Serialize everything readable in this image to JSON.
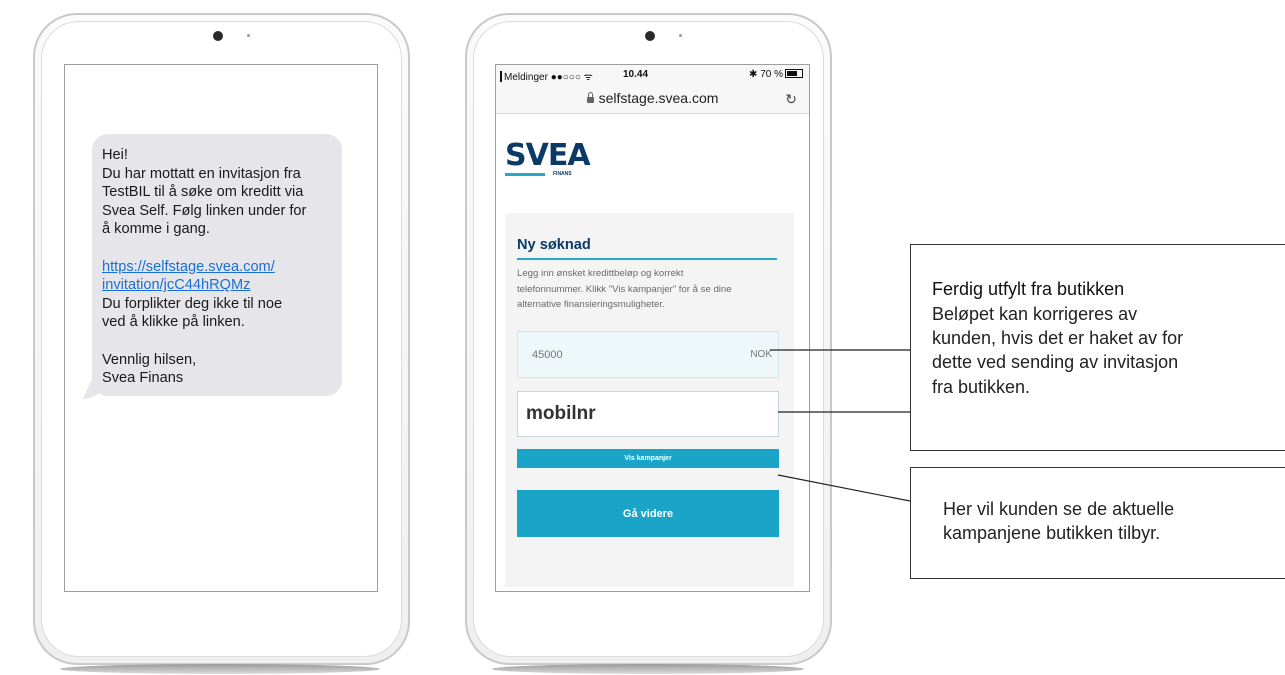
{
  "sms": {
    "lines": [
      "Hei!",
      "Du har mottatt en invitasjon fra",
      "TestBIL til å søke om kreditt via",
      "Svea Self. Følg linken under for",
      "å komme i gang."
    ],
    "link_lines": [
      "https://selfstage.svea.com/",
      "invitation/jcC44hRQMz"
    ],
    "after_link_lines": [
      "Du forplikter deg ikke til noe",
      "ved å klikke på linken."
    ],
    "signature_lines": [
      "Vennlig hilsen,",
      "Svea Finans"
    ]
  },
  "browser": {
    "status_left": "Meldinger ●●○○○ ᯤ",
    "time": "10.44",
    "status_right": "✱ 70 %",
    "url": "selfstage.svea.com"
  },
  "app": {
    "logo": "SVEA",
    "logo_sub": "FINANS",
    "title": "Ny søknad",
    "description_lines": [
      "Legg inn ønsket kredittbeløp og korrekt",
      "telefonnummer. Klikk \"Vis kampanjer\" for å se dine",
      "alternative finansieringsmuligheter."
    ],
    "amount_value": "45000",
    "amount_unit": "NOK",
    "phone_placeholder": "mobilnr",
    "campaign_button": "Vis kampanjer",
    "next_button": "Gå videre"
  },
  "callouts": {
    "prefilled_title": "Ferdig utfylt fra butikken",
    "prefilled_lines": [
      "Beløpet kan korrigeres av",
      "kunden, hvis det er haket av for",
      "dette ved sending av invitasjon",
      "fra butikken."
    ],
    "campaign_lines": [
      "Her vil kunden se de aktuelle",
      "kampanjene butikken tilbyr."
    ]
  }
}
